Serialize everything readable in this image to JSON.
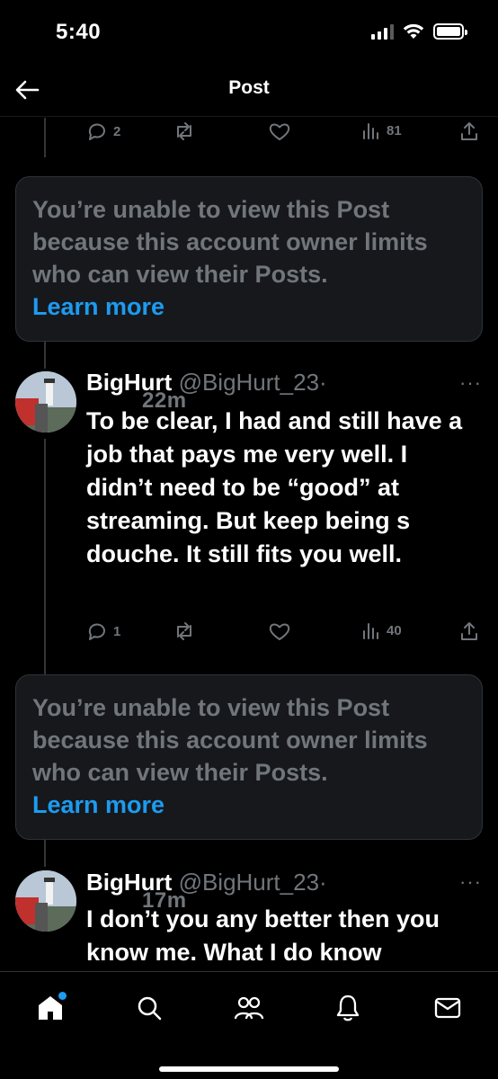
{
  "status_bar": {
    "time": "5:40"
  },
  "header": {
    "title": "Post"
  },
  "top_actions": {
    "replies": "2",
    "views": "81"
  },
  "unavailable_1": {
    "message": "You’re unable to view this Post because this account owner limits who can view their Posts.",
    "link": "Learn more"
  },
  "tweet_1": {
    "name": "BigHurt",
    "handle": "@BigHurt_23",
    "dot": "·",
    "time": "22m",
    "more": "···",
    "text": "To be clear, I had and still have a job that pays me very well. I didn’t need to be “good” at streaming. But keep being s douche. It still fits you well.",
    "replies": "1",
    "views": "40"
  },
  "unavailable_2": {
    "message": "You’re unable to view this Post because this account owner limits who can view their Posts.",
    "link": "Learn more"
  },
  "tweet_2": {
    "name": "BigHurt",
    "handle": "@BigHurt_23",
    "dot": "·",
    "time": "17m",
    "more": "···",
    "text": "I don’t you any better then you know me. What I do know"
  },
  "tabbar": {
    "items": [
      "home-icon",
      "search-icon",
      "communities-icon",
      "notifications-icon",
      "messages-icon"
    ]
  },
  "colors": {
    "accent": "#1d9bf0",
    "muted": "#71767b",
    "background": "#000000",
    "card": "#16181c"
  }
}
